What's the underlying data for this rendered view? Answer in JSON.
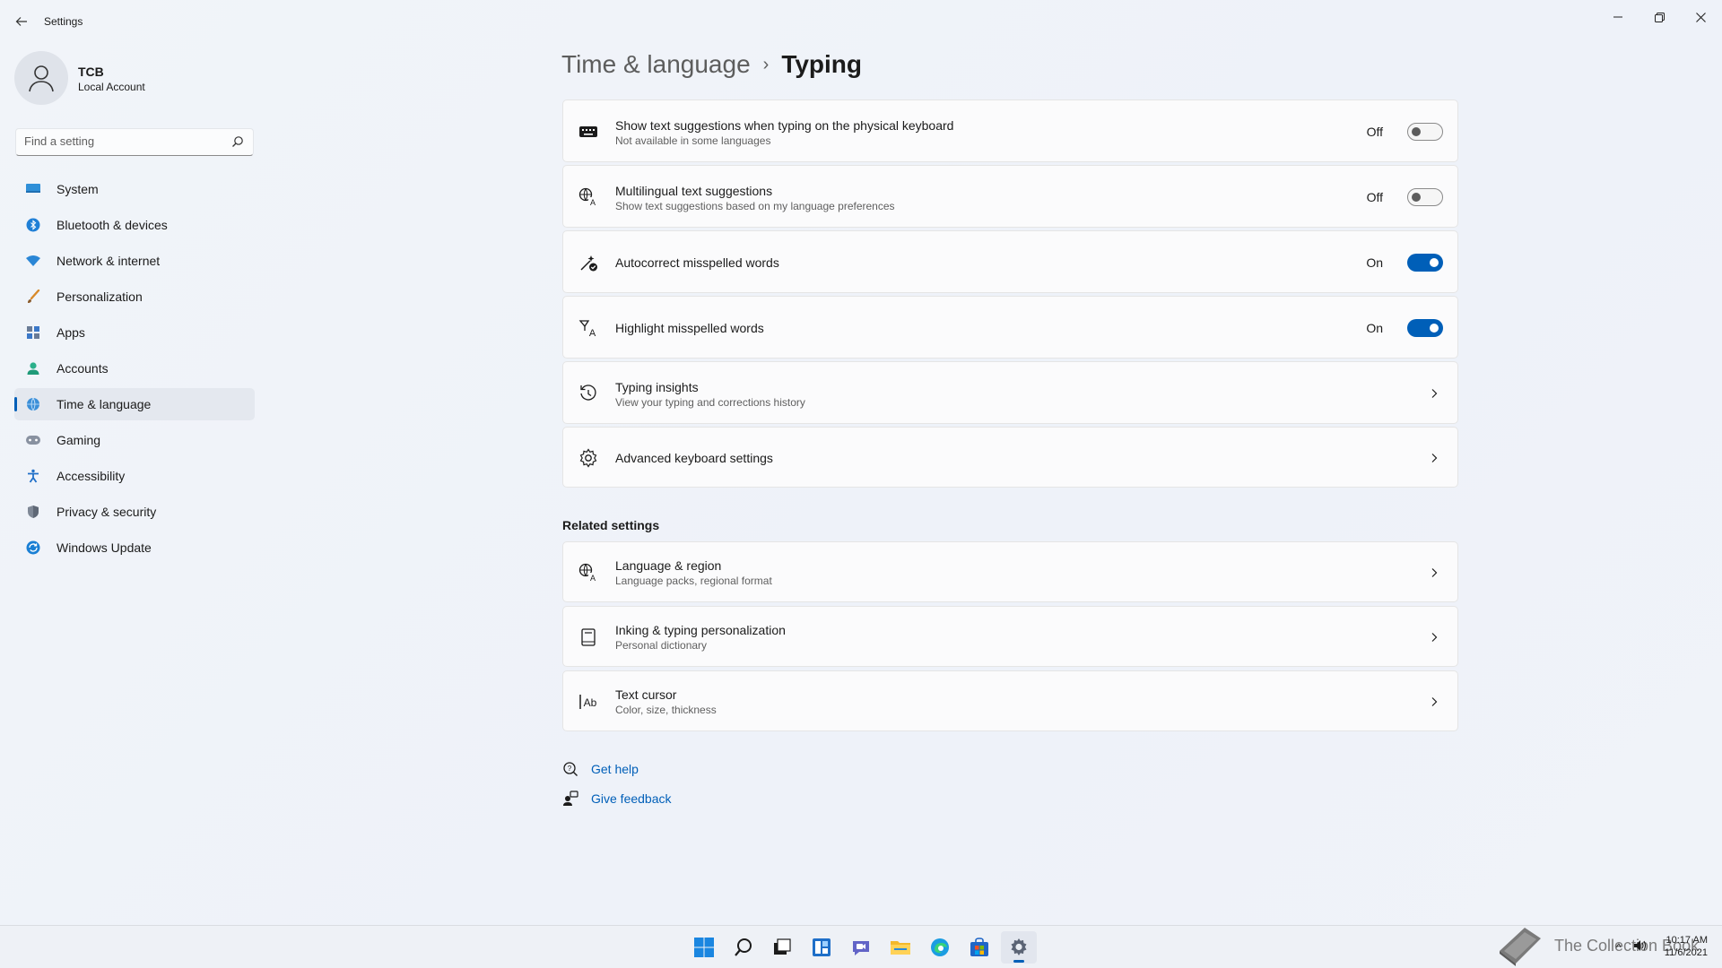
{
  "window": {
    "title": "Settings",
    "back_icon": "back-arrow-icon",
    "controls": [
      "minimize-icon",
      "restore-icon",
      "close-icon"
    ]
  },
  "profile": {
    "name": "TCB",
    "account_type": "Local Account"
  },
  "search": {
    "placeholder": "Find a setting",
    "value": ""
  },
  "nav": {
    "items": [
      {
        "label": "System",
        "icon": "system-icon"
      },
      {
        "label": "Bluetooth & devices",
        "icon": "bluetooth-icon"
      },
      {
        "label": "Network & internet",
        "icon": "wifi-icon"
      },
      {
        "label": "Personalization",
        "icon": "brush-icon"
      },
      {
        "label": "Apps",
        "icon": "apps-icon"
      },
      {
        "label": "Accounts",
        "icon": "accounts-icon"
      },
      {
        "label": "Time & language",
        "icon": "globe-clock-icon",
        "selected": true
      },
      {
        "label": "Gaming",
        "icon": "gamepad-icon"
      },
      {
        "label": "Accessibility",
        "icon": "accessibility-icon"
      },
      {
        "label": "Privacy & security",
        "icon": "shield-icon"
      },
      {
        "label": "Windows Update",
        "icon": "update-icon"
      }
    ]
  },
  "breadcrumb": {
    "parent": "Time & language",
    "separator": "›",
    "current": "Typing"
  },
  "settings": [
    {
      "title": "Show text suggestions when typing on the physical keyboard",
      "subtitle": "Not available in some languages",
      "state": "Off",
      "icon": "keyboard-icon"
    },
    {
      "title": "Multilingual text suggestions",
      "subtitle": "Show text suggestions based on my language preferences",
      "state": "Off",
      "icon": "language-icon"
    },
    {
      "title": "Autocorrect misspelled words",
      "subtitle": "",
      "state": "On",
      "icon": "autocorrect-icon"
    },
    {
      "title": "Highlight misspelled words",
      "subtitle": "",
      "state": "On",
      "icon": "highlight-icon"
    },
    {
      "title": "Typing insights",
      "subtitle": "View your typing and corrections history",
      "icon": "history-icon"
    },
    {
      "title": "Advanced keyboard settings",
      "subtitle": "",
      "icon": "gear-icon"
    }
  ],
  "related": {
    "heading": "Related settings",
    "items": [
      {
        "title": "Language & region",
        "subtitle": "Language packs, regional format",
        "icon": "language-icon"
      },
      {
        "title": "Inking & typing personalization",
        "subtitle": "Personal dictionary",
        "icon": "notebook-icon"
      },
      {
        "title": "Text cursor",
        "subtitle": "Color, size, thickness",
        "icon": "text-cursor-icon"
      }
    ]
  },
  "help": {
    "get_help": "Get help",
    "give_feedback": "Give feedback"
  },
  "taskbar": {
    "apps": [
      "start-icon",
      "search-icon",
      "task-view-icon",
      "widgets-icon",
      "teams-chat-icon",
      "file-explorer-icon",
      "edge-icon",
      "store-icon",
      "settings-icon"
    ],
    "watermark": "The Collection Book",
    "time": "10:17 AM",
    "date": "11/6/2021"
  },
  "colors": {
    "accent": "#005fb8",
    "background": "#eef2f8",
    "card": "#fbfbfc"
  }
}
